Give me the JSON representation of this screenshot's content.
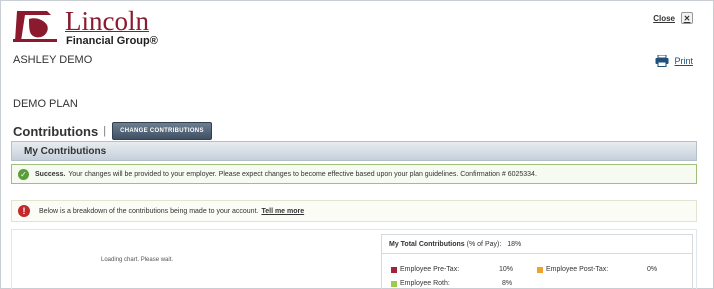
{
  "brand": {
    "name": "Lincoln",
    "subtitle": "Financial Group®"
  },
  "header": {
    "close_label": "Close",
    "close_icon": "close-x-icon",
    "print_label": "Print",
    "print_icon": "printer-icon"
  },
  "user_name": "ASHLEY DEMO",
  "plan_name": "DEMO PLAN",
  "contributions": {
    "title": "Contributions",
    "separator": "|",
    "change_button": "CHANGE CONTRIBUTIONS"
  },
  "section": {
    "title": "My Contributions"
  },
  "success": {
    "label": "Success.",
    "message": "Your changes will be provided to your employer. Please expect changes to become effective based upon your plan guidelines. Confirmation # 6025334."
  },
  "info": {
    "message": "Below is a breakdown of the contributions being made to your account.",
    "link": "Tell me more"
  },
  "chart": {
    "loading_text": "Loading chart. Please wait."
  },
  "totals": {
    "heading": "My Total Contributions",
    "heading_suffix": "(% of Pay):",
    "total_value": "18%",
    "items": [
      {
        "label": "Employee Pre-Tax:",
        "value": "10%",
        "color": "#a3233a"
      },
      {
        "label": "Employee Post-Tax:",
        "value": "0%",
        "color": "#f0a22e"
      },
      {
        "label": "Employee Roth:",
        "value": "8%",
        "color": "#9ccc4a"
      }
    ]
  },
  "colors": {
    "brand": "#8c1a2f",
    "success": "#5a9e3a",
    "alert": "#c4282c"
  }
}
